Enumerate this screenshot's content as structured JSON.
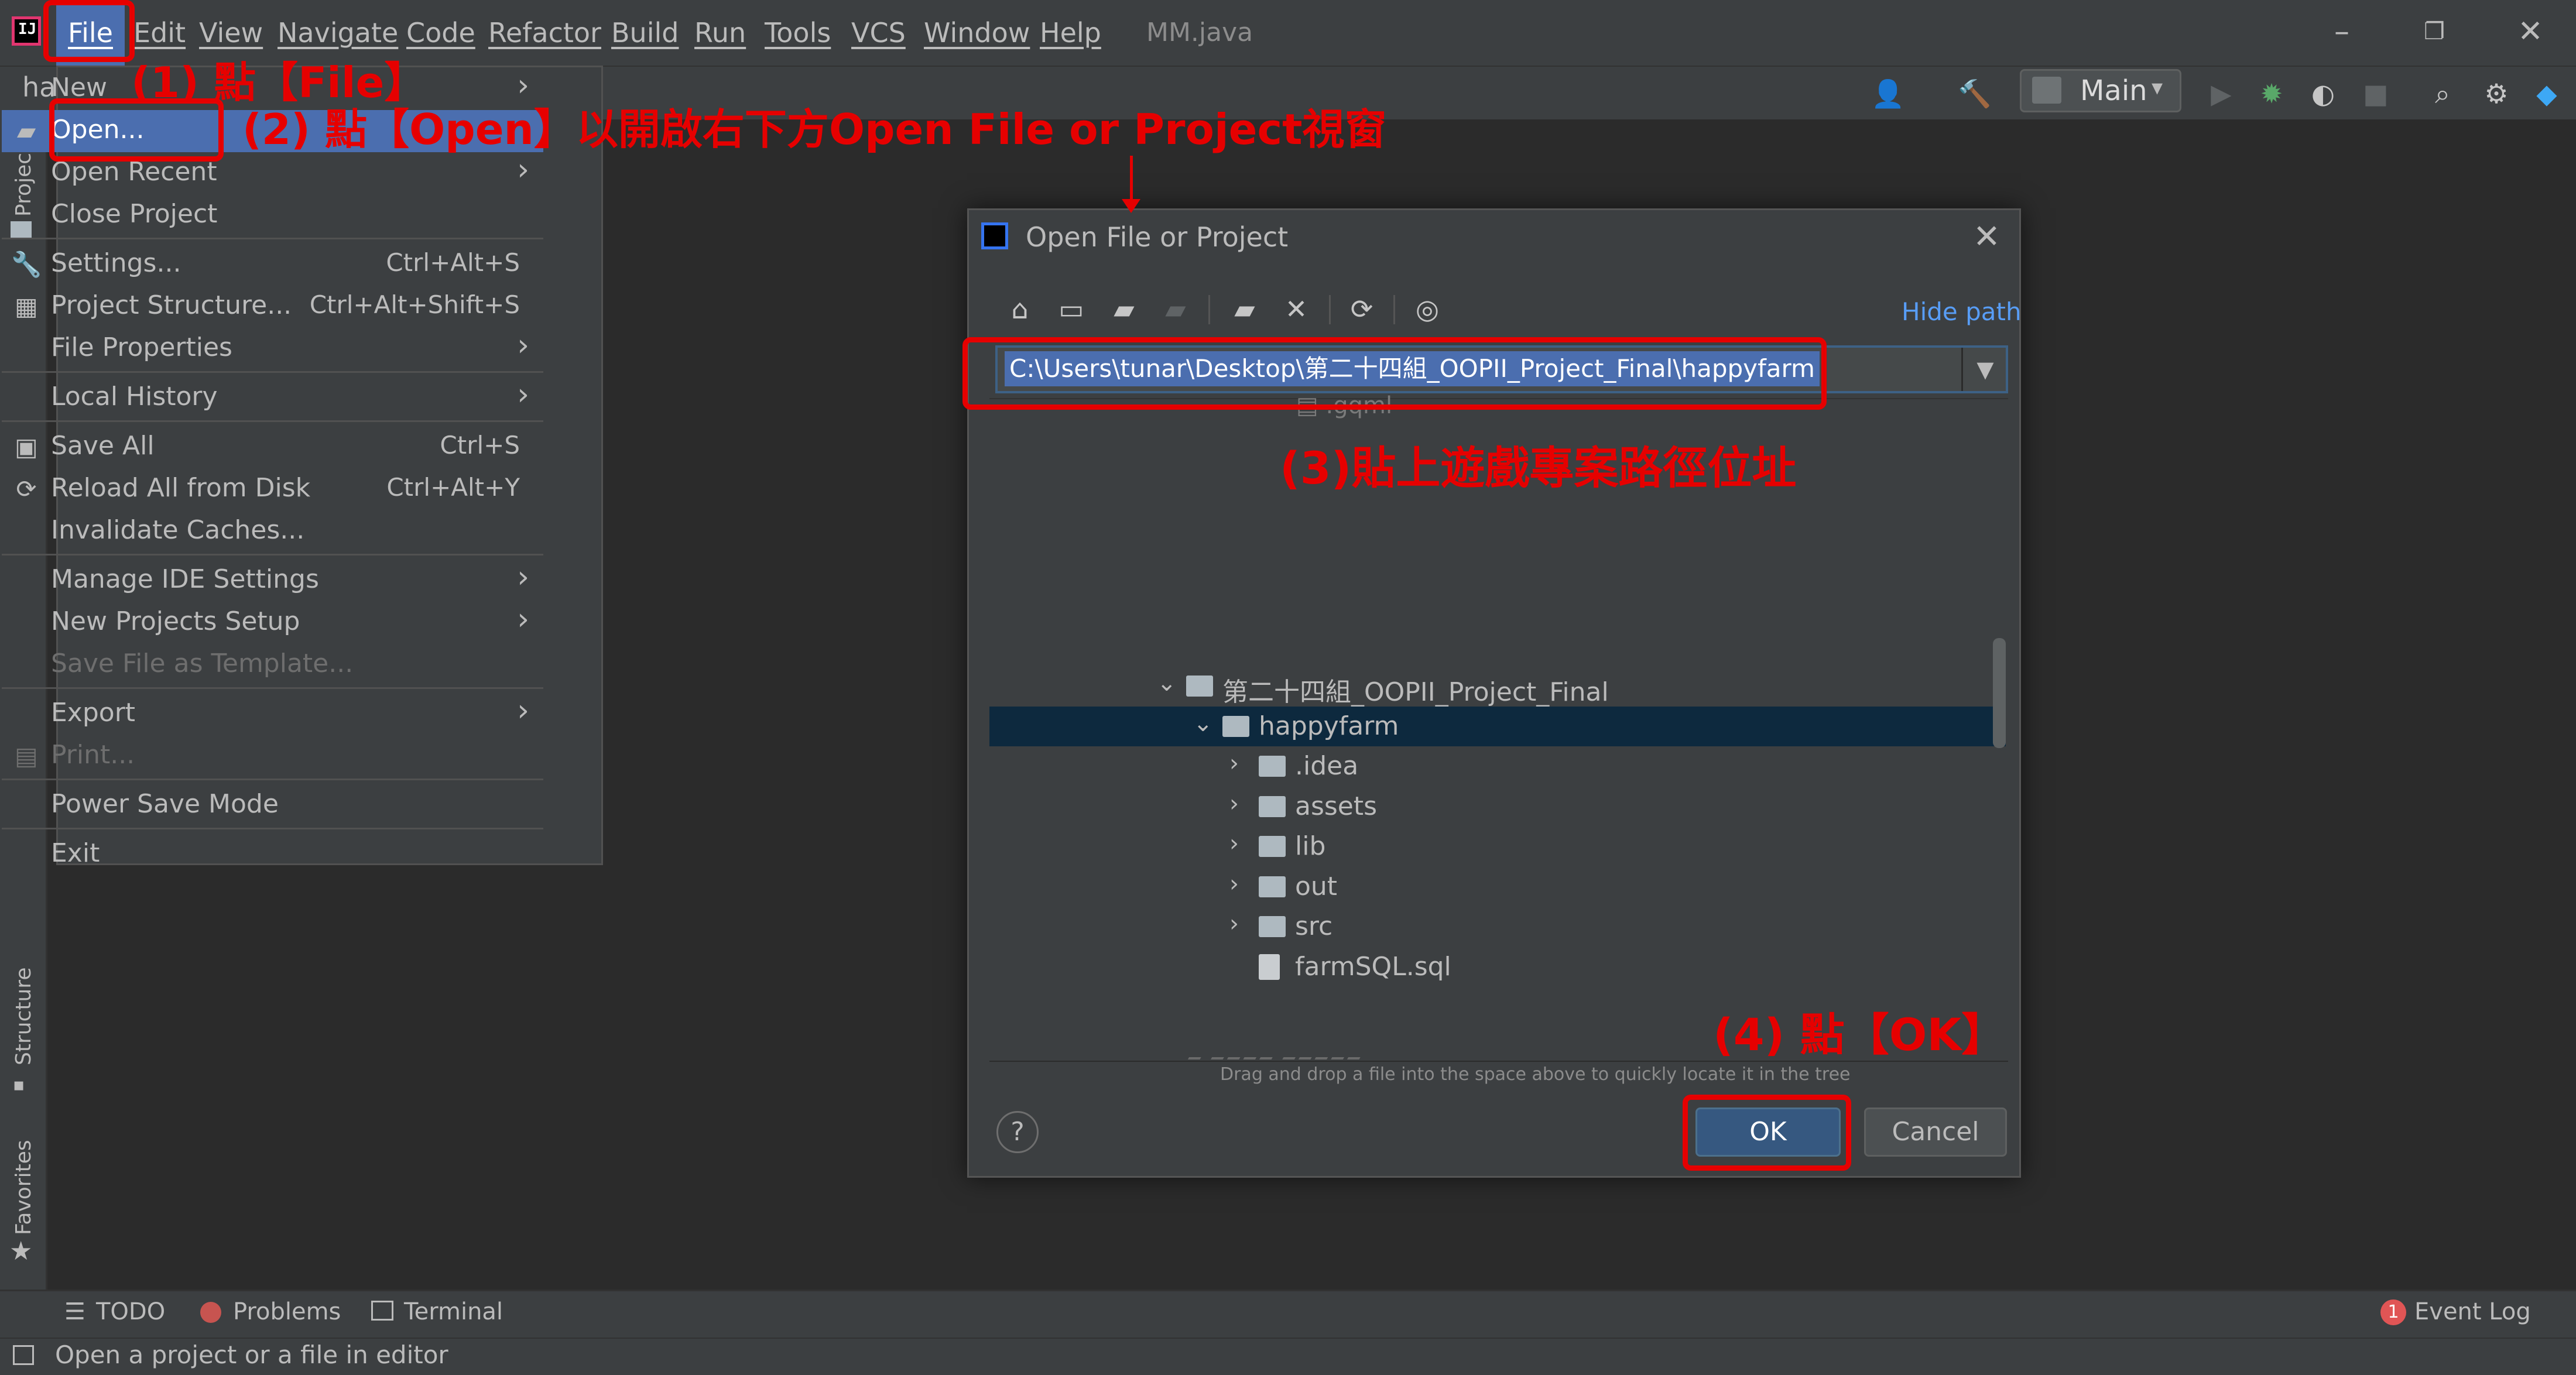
{
  "window": {
    "title": "MM.java"
  },
  "menubar": {
    "items": [
      "File",
      "Edit",
      "View",
      "Navigate",
      "Code",
      "Refactor",
      "Build",
      "Run",
      "Tools",
      "VCS",
      "Window",
      "Help"
    ]
  },
  "toolbar": {
    "project_fragment": "ha",
    "run_config": "Main"
  },
  "leftbar": {
    "project": "Project",
    "structure": "Structure",
    "favorites": "Favorites"
  },
  "file_menu": {
    "items": [
      {
        "label": "New",
        "shortcut": "",
        "submenu": true
      },
      {
        "label": "Open...",
        "shortcut": "",
        "submenu": false
      },
      {
        "label": "Open Recent",
        "shortcut": "",
        "submenu": true
      },
      {
        "label": "Close Project",
        "shortcut": "",
        "submenu": false
      },
      {
        "label": "Settings...",
        "shortcut": "Ctrl+Alt+S",
        "submenu": false
      },
      {
        "label": "Project Structure...",
        "shortcut": "Ctrl+Alt+Shift+S",
        "submenu": false
      },
      {
        "label": "File Properties",
        "shortcut": "",
        "submenu": true
      },
      {
        "label": "Local History",
        "shortcut": "",
        "submenu": true
      },
      {
        "label": "Save All",
        "shortcut": "Ctrl+S",
        "submenu": false
      },
      {
        "label": "Reload All from Disk",
        "shortcut": "Ctrl+Alt+Y",
        "submenu": false
      },
      {
        "label": "Invalidate Caches...",
        "shortcut": "",
        "submenu": false
      },
      {
        "label": "Manage IDE Settings",
        "shortcut": "",
        "submenu": true
      },
      {
        "label": "New Projects Setup",
        "shortcut": "",
        "submenu": true
      },
      {
        "label": "Save File as Template...",
        "shortcut": "",
        "submenu": false
      },
      {
        "label": "Export",
        "shortcut": "",
        "submenu": true
      },
      {
        "label": "Print...",
        "shortcut": "",
        "submenu": false
      },
      {
        "label": "Power Save Mode",
        "shortcut": "",
        "submenu": false
      },
      {
        "label": "Exit",
        "shortcut": "",
        "submenu": false
      }
    ]
  },
  "dialog": {
    "title": "Open File or Project",
    "hide_path": "Hide path",
    "path": "C:\\Users\\tunar\\Desktop\\第二十四組_OOPII_Project_Final\\happyfarm",
    "tree": [
      {
        "label": "第二十四組_OOPII_Project_Final",
        "depth": 0,
        "expanded": true,
        "type": "folder"
      },
      {
        "label": "happyfarm",
        "depth": 1,
        "expanded": true,
        "type": "project",
        "selected": true
      },
      {
        "label": ".idea",
        "depth": 2,
        "expanded": false,
        "type": "folder"
      },
      {
        "label": "assets",
        "depth": 2,
        "expanded": false,
        "type": "folder"
      },
      {
        "label": "lib",
        "depth": 2,
        "expanded": false,
        "type": "folder"
      },
      {
        "label": "out",
        "depth": 2,
        "expanded": false,
        "type": "folder"
      },
      {
        "label": "src",
        "depth": 2,
        "expanded": false,
        "type": "folder"
      },
      {
        "label": "farmSQL.sql",
        "depth": 2,
        "expanded": false,
        "type": "file"
      }
    ],
    "hint": "Drag and drop a file into the space above to quickly locate it in the tree",
    "help": "?",
    "ok": "OK",
    "cancel": "Cancel"
  },
  "bottombar": {
    "todo": "TODO",
    "problems": "Problems",
    "terminal": "Terminal",
    "event_log": "Event Log",
    "event_count": "1"
  },
  "statusbar": {
    "text": "Open a project or a file in editor"
  },
  "annotations": {
    "step1": "(1) 點【File】",
    "step2": "(2) 點【Open】以開啟右下方Open File or Project視窗",
    "step3": "(3)貼上遊戲專案路徑位址",
    "step4": "(4) 點【OK】"
  },
  "colors": {
    "annotation": "#e60000",
    "selection": "#4b6eaf",
    "ok_button": "#365880",
    "background": "#2b2b2b",
    "panel": "#3c3f41"
  }
}
